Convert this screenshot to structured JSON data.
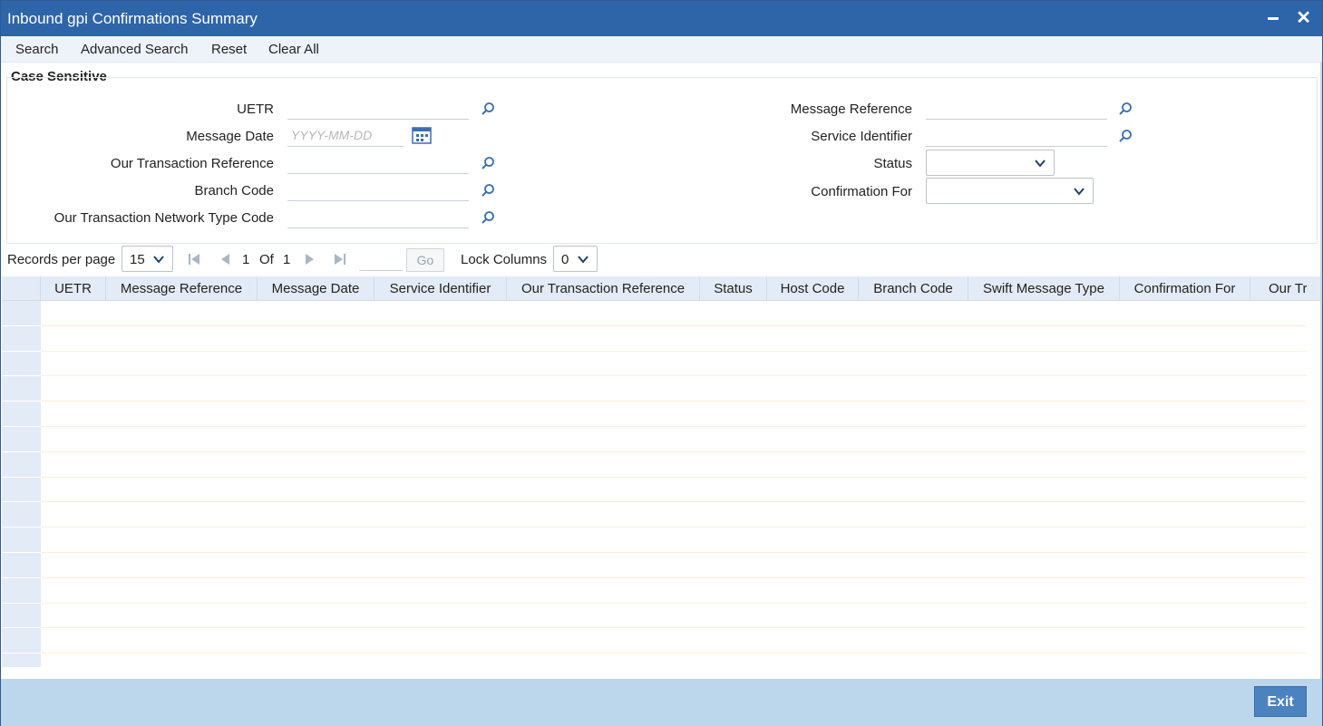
{
  "window": {
    "title": "Inbound gpi Confirmations Summary"
  },
  "toolbar": {
    "search": "Search",
    "advanced_search": "Advanced Search",
    "reset": "Reset",
    "clear_all": "Clear All"
  },
  "criteria": {
    "section_title": "Case Sensitive",
    "uetr": {
      "label": "UETR",
      "value": ""
    },
    "message_date": {
      "label": "Message Date",
      "placeholder": "YYYY-MM-DD",
      "value": ""
    },
    "our_txn_ref": {
      "label": "Our Transaction Reference",
      "value": ""
    },
    "branch_code": {
      "label": "Branch Code",
      "value": ""
    },
    "our_txn_network_type": {
      "label": "Our Transaction Network Type Code",
      "value": ""
    },
    "message_reference": {
      "label": "Message Reference",
      "value": ""
    },
    "service_identifier": {
      "label": "Service Identifier",
      "value": ""
    },
    "status": {
      "label": "Status",
      "value": ""
    },
    "confirmation_for": {
      "label": "Confirmation For",
      "value": ""
    }
  },
  "pager": {
    "records_per_page_label": "Records per page",
    "records_per_page": "15",
    "current_page": "1",
    "of_label": "Of",
    "total_pages": "1",
    "go_label": "Go",
    "lock_columns_label": "Lock Columns",
    "lock_columns": "0"
  },
  "grid": {
    "columns": [
      "UETR",
      "Message Reference",
      "Message Date",
      "Service Identifier",
      "Our Transaction Reference",
      "Status",
      "Host Code",
      "Branch Code",
      "Swift Message Type",
      "Confirmation For",
      "Our Tr"
    ],
    "rows": []
  },
  "footer": {
    "exit": "Exit"
  },
  "icons": {
    "lookup": "search-icon",
    "calendar": "calendar-icon",
    "dropdown": "chevron-down-icon"
  },
  "colors": {
    "titlebar": "#2e64a8",
    "accent": "#4a83bf",
    "footer": "#bcd6ec",
    "grid_header": "#e3ebf6"
  }
}
